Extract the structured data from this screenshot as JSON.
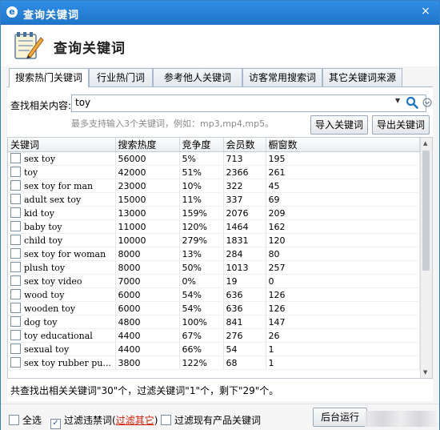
{
  "window": {
    "title": "查询关键词"
  },
  "header": {
    "title": "查询关键词"
  },
  "tabs": [
    "搜索热门关键词",
    "行业热门词",
    "参考他人关键词",
    "访客常用搜索词",
    "其它关键词来源"
  ],
  "query": {
    "label": "查找相关内容:",
    "value": "toy",
    "hint": "最多支持输入3个关键词，例如：mp3,mp4,mp5。"
  },
  "buttons": {
    "import": "导入关键词",
    "export": "导出关键词",
    "background": "后台运行"
  },
  "table": {
    "headers": [
      "关键词",
      "搜索热度",
      "竞争度",
      "会员数",
      "橱窗数"
    ],
    "rows": [
      [
        "sex toy",
        "56000",
        "5%",
        "713",
        "195"
      ],
      [
        "toy",
        "42000",
        "51%",
        "2366",
        "261"
      ],
      [
        "sex toy for man",
        "23000",
        "10%",
        "322",
        "45"
      ],
      [
        "adult sex toy",
        "15000",
        "11%",
        "337",
        "69"
      ],
      [
        "kid toy",
        "13000",
        "159%",
        "2076",
        "209"
      ],
      [
        "baby toy",
        "11000",
        "120%",
        "1464",
        "162"
      ],
      [
        "child toy",
        "10000",
        "279%",
        "1831",
        "120"
      ],
      [
        "sex toy for woman",
        "8000",
        "13%",
        "284",
        "80"
      ],
      [
        "plush toy",
        "8000",
        "50%",
        "1013",
        "257"
      ],
      [
        "sex toy video",
        "7000",
        "0%",
        "19",
        "0"
      ],
      [
        "wood toy",
        "6000",
        "54%",
        "636",
        "126"
      ],
      [
        "wooden toy",
        "6000",
        "54%",
        "636",
        "126"
      ],
      [
        "dog toy",
        "4800",
        "100%",
        "841",
        "147"
      ],
      [
        "toy educational",
        "4400",
        "67%",
        "276",
        "26"
      ],
      [
        "sexual toy",
        "4400",
        "66%",
        "54",
        "1"
      ],
      [
        "sex toy rubber pu...",
        "3800",
        "122%",
        "68",
        "1"
      ]
    ]
  },
  "status": "共查找出相关关键词\"30\"个，过滤关键词\"1\"个，剩下\"29\"个。",
  "footer": {
    "select_all": "全选",
    "filter_banned": "过滤违禁词(",
    "filter_other": "过滤其它",
    "filter_banned_close": ")",
    "filter_existing": "过滤现有产品关键词"
  },
  "colors": {
    "titlebar": "#1f74c8",
    "red_link": "#d81e06"
  }
}
